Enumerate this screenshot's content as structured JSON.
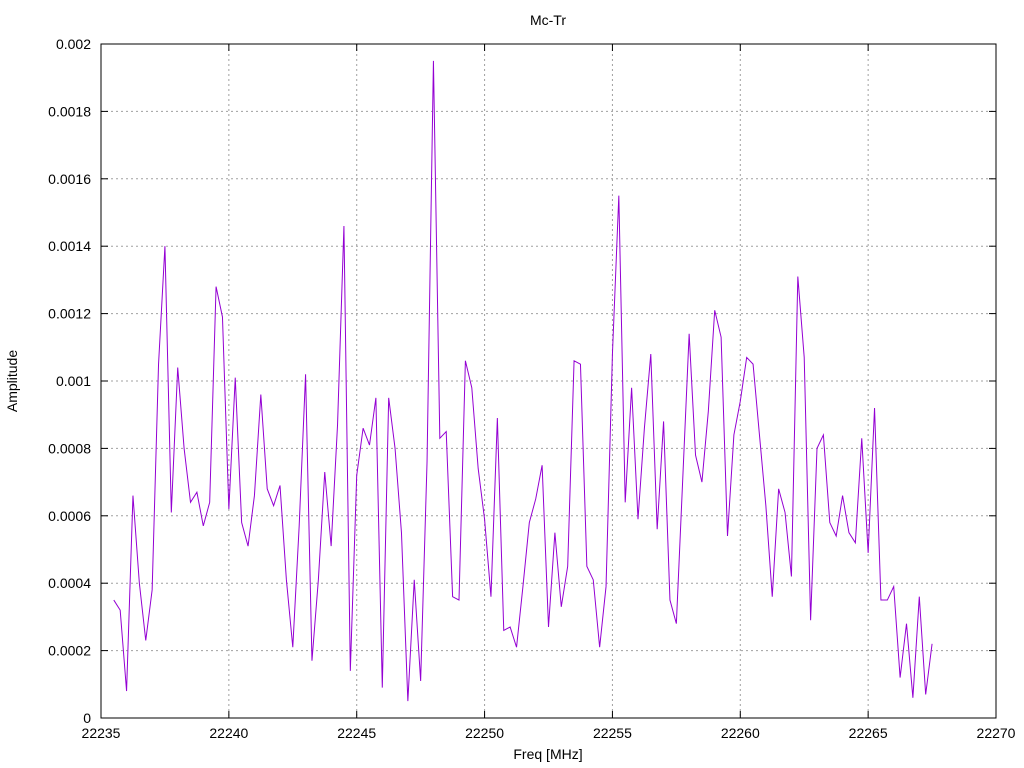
{
  "chart_data": {
    "type": "line",
    "title": "Mc-Tr",
    "xlabel": "Freq [MHz]",
    "ylabel": "Amplitude",
    "xlim": [
      22235,
      22270
    ],
    "ylim": [
      0,
      0.002
    ],
    "x_ticks": [
      22235,
      22240,
      22245,
      22250,
      22255,
      22260,
      22265,
      22270
    ],
    "x_tick_labels": [
      "22235",
      "22240",
      "22245",
      "22250",
      "22255",
      "22260",
      "22265",
      "22270"
    ],
    "y_ticks": [
      0,
      0.0002,
      0.0004,
      0.0006,
      0.0008,
      0.001,
      0.0012,
      0.0014,
      0.0016,
      0.0018,
      0.002
    ],
    "y_tick_labels": [
      "0",
      "0.0002",
      "0.0004",
      "0.0006",
      "0.0008",
      "0.001",
      "0.0012",
      "0.0014",
      "0.0016",
      "0.0018",
      "0.002"
    ],
    "grid": true,
    "series_color": "#9400d3",
    "series": [
      {
        "x_start": 22235.5,
        "x_step": 0.25,
        "values": [
          0.00035,
          0.00032,
          8e-05,
          0.00066,
          0.0004,
          0.00023,
          0.00038,
          0.00105,
          0.0014,
          0.00061,
          0.00104,
          0.0008,
          0.00064,
          0.00067,
          0.00057,
          0.00064,
          0.00128,
          0.00119,
          0.00062,
          0.00101,
          0.00058,
          0.00051,
          0.00066,
          0.00096,
          0.00068,
          0.00063,
          0.00069,
          0.00041,
          0.00021,
          0.00057,
          0.00102,
          0.00017,
          0.00041,
          0.00073,
          0.00051,
          0.00087,
          0.00146,
          0.00014,
          0.00072,
          0.00086,
          0.00081,
          0.00095,
          9e-05,
          0.00095,
          0.0008,
          0.00055,
          5e-05,
          0.00041,
          0.00011,
          0.00076,
          0.00195,
          0.00083,
          0.00085,
          0.00036,
          0.00035,
          0.00106,
          0.00098,
          0.00074,
          0.00059,
          0.00036,
          0.00089,
          0.00026,
          0.00027,
          0.00021,
          0.00039,
          0.00058,
          0.00065,
          0.00075,
          0.00027,
          0.00055,
          0.00033,
          0.00045,
          0.00106,
          0.00105,
          0.00045,
          0.00041,
          0.00021,
          0.00039,
          0.00108,
          0.00155,
          0.00064,
          0.00098,
          0.00059,
          0.00086,
          0.00108,
          0.00056,
          0.00088,
          0.00035,
          0.00028,
          0.00071,
          0.00114,
          0.00078,
          0.0007,
          0.00091,
          0.00121,
          0.00113,
          0.00054,
          0.00084,
          0.00094,
          0.00107,
          0.00105,
          0.00084,
          0.00063,
          0.00036,
          0.00068,
          0.00061,
          0.00042,
          0.00131,
          0.00107,
          0.00029,
          0.0008,
          0.00084,
          0.00058,
          0.00054,
          0.00066,
          0.00055,
          0.00052,
          0.00083,
          0.00049,
          0.00092,
          0.00035,
          0.00035,
          0.00039,
          0.00012,
          0.00028,
          6e-05,
          0.00036,
          7e-05,
          0.00022
        ]
      }
    ]
  }
}
